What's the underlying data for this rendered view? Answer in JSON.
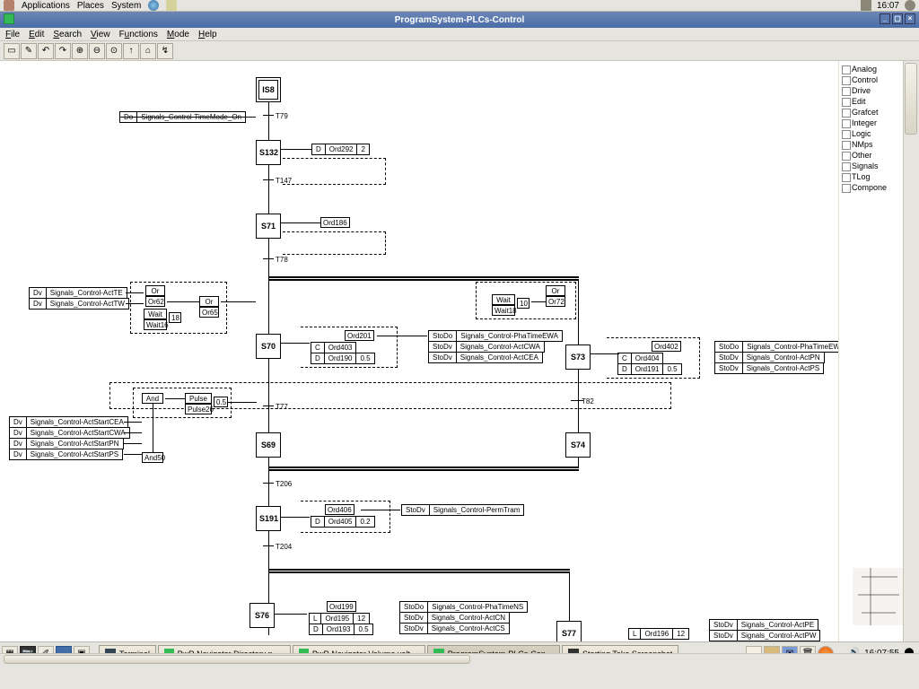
{
  "panel": {
    "menus": [
      "Applications",
      "Places",
      "System"
    ],
    "clock": "16:07"
  },
  "titlebar": {
    "title": "ProgramSystem-PLCs-Control"
  },
  "menubar": {
    "items": [
      "File",
      "Edit",
      "Search",
      "View",
      "Functions",
      "Mode",
      "Help"
    ]
  },
  "palette": {
    "items": [
      "Analog",
      "Control",
      "Drive",
      "Edit",
      "Grafcet",
      "Integer",
      "Logic",
      "NMps",
      "Other",
      "Signals",
      "TLog",
      "Compone"
    ]
  },
  "steps": {
    "IS8": "IS8",
    "S132": "S132",
    "S71": "S71",
    "S70": "S70",
    "S69": "S69",
    "S191": "S191",
    "S76": "S76",
    "S73": "S73",
    "S74": "S74",
    "S77": "S77"
  },
  "trans": {
    "T79": "T79",
    "T147": "T147",
    "T78": "T78",
    "T77": "T77",
    "T206": "T206",
    "T204": "T204",
    "T82": "T82"
  },
  "actions": {
    "timeMode": {
      "k": "Do",
      "v": "Signals_Control-TimeMode_On"
    },
    "ord292": {
      "k": "D",
      "v": "Ord292",
      "n": "2"
    },
    "ord186": "Ord186",
    "left_te": {
      "k": "Dv",
      "v": "Signals_Control-ActTE"
    },
    "left_tw": {
      "k": "Dv",
      "v": "Signals_Control-ActTW"
    },
    "or62": "Or62",
    "or": "Or",
    "or65": "Or65",
    "wait16": "Wait16",
    "wait": "Wait",
    "wait18": "Wait18",
    "n18": "18",
    "n10": "10",
    "or72": "Or72",
    "s70_ord201": "Ord201",
    "s70_c": {
      "k": "C",
      "v": "Ord403"
    },
    "s70_d": {
      "k": "D",
      "v": "Ord190",
      "n": "0.5"
    },
    "s70_r1": {
      "k": "StoDo",
      "v": "Signals_Control-PhaTimeEWA"
    },
    "s70_r2": {
      "k": "StoDv",
      "v": "Signals_Control-ActCWA"
    },
    "s70_r3": {
      "k": "StoDv",
      "v": "Signals_Control-ActCEA"
    },
    "s73_ord402": "Ord402",
    "s73_c": {
      "k": "C",
      "v": "Ord404"
    },
    "s73_d": {
      "k": "D",
      "v": "Ord191",
      "n": "0.5"
    },
    "s73_r1": {
      "k": "StoDo",
      "v": "Signals_Control-PhaTimeEWA"
    },
    "s73_r2": {
      "k": "StoDv",
      "v": "Signals_Control-ActPN"
    },
    "s73_r3": {
      "k": "StoDv",
      "v": "Signals_Control-ActPS"
    },
    "and": "And",
    "and50": "And50",
    "pulse": "Pulse",
    "pulse26": "Pulse26",
    "p05": "0.5",
    "cea": {
      "k": "Dv",
      "v": "Signals_Control-ActStartCEA"
    },
    "cwa": {
      "k": "Dv",
      "v": "Signals_Control-ActStartCWA"
    },
    "pn": {
      "k": "Dv",
      "v": "Signals_Control-ActStartPN"
    },
    "ps": {
      "k": "Dv",
      "v": "Signals_Control-ActStartPS"
    },
    "ord406": "Ord406",
    "s191_d": {
      "k": "D",
      "v": "Ord405",
      "n": "0.2"
    },
    "s191_r": {
      "k": "StoDv",
      "v": "Signals_Control-PermTram"
    },
    "ord199": "Ord199",
    "s76_l": {
      "k": "L",
      "v": "Ord195",
      "n": "12"
    },
    "s76_d": {
      "k": "D",
      "v": "Ord193",
      "n": "0.5"
    },
    "s76_r1": {
      "k": "StoDo",
      "v": "Signals_Control-PhaTimeNS"
    },
    "s76_r2": {
      "k": "StoDv",
      "v": "Signals_Control-ActCN"
    },
    "s76_r3": {
      "k": "StoDv",
      "v": "Signals_Control-ActCS"
    },
    "s77_l": {
      "k": "L",
      "v": "Ord196",
      "n": "12"
    },
    "s77_r1": {
      "k": "StoDv",
      "v": "Signals_Control-ActPE"
    },
    "s77_r2": {
      "k": "StoDv",
      "v": "Signals_Control-ActPW"
    }
  },
  "taskbar": {
    "tasks": [
      "Terminal",
      "PwR Navigator Directory pwrp o...",
      "PwR Navigator Volume voltraffi...",
      "ProgramSystem-PLCs-Control",
      "Starting Take Screenshot"
    ],
    "clock": "16:07:55"
  }
}
